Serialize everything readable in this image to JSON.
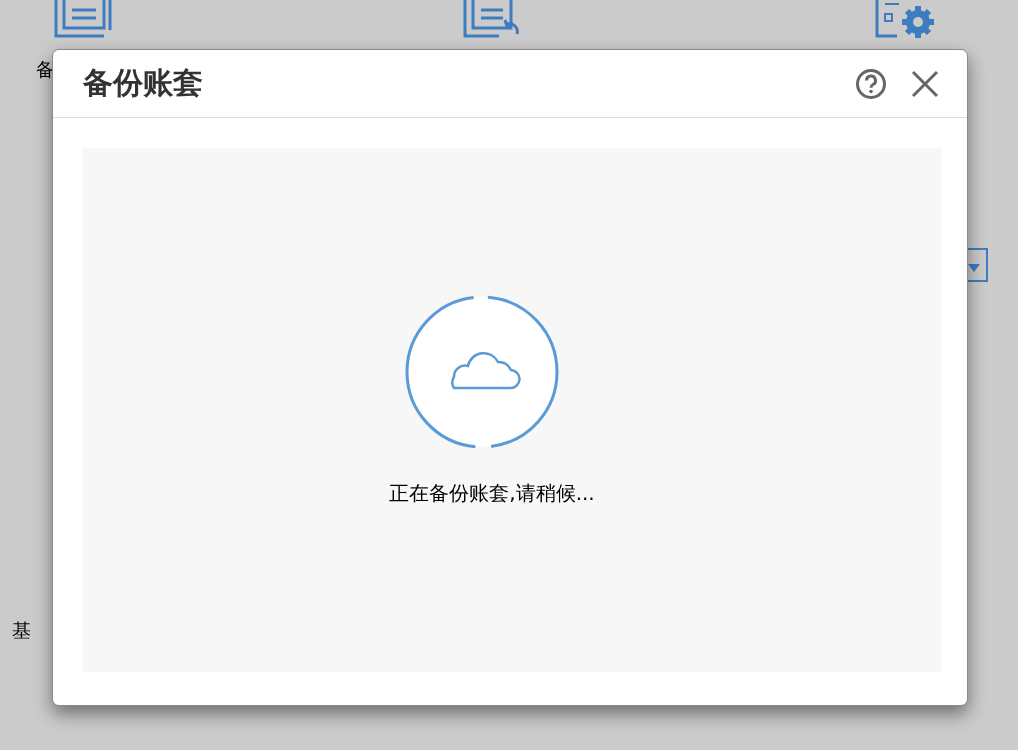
{
  "background": {
    "labels": [
      {
        "text": "备"
      },
      {
        "text": "基"
      }
    ]
  },
  "dialog": {
    "title": "备份账套",
    "message": "正在备份账套,请稍候..."
  }
}
